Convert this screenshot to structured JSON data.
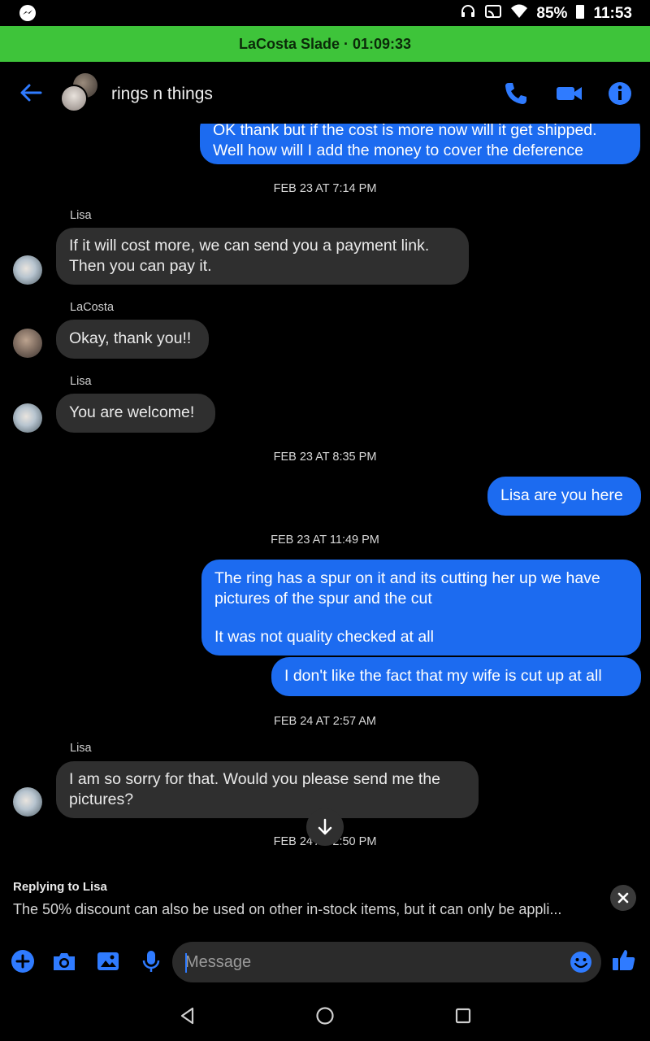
{
  "status_bar": {
    "battery": "85%",
    "time": "11:53"
  },
  "call_banner": {
    "text": "LaCosta Slade · 01:09:33"
  },
  "header": {
    "title": "rings n things"
  },
  "messages": {
    "out_top_line1": "OK thank but if the cost is more now will it get shipped.",
    "out_top_line2": "Well how will I add the money to cover the deference",
    "ts1": "FEB 23 AT 7:14 PM",
    "sender_lisa_1": "Lisa",
    "in1_line1": "If it will cost more, we can send you a payment link.",
    "in1_line2": "Then you can pay it.",
    "sender_lacosta": "LaCosta",
    "in2": "Okay, thank you!!",
    "sender_lisa_2": "Lisa",
    "in3": "You are welcome!",
    "ts2": "FEB 23 AT 8:35 PM",
    "out2": "Lisa are you here",
    "ts3": "FEB 23 AT 11:49 PM",
    "out3_line1": "The ring has a spur on it and its cutting her up we have",
    "out3_line2": "pictures of the spur and the cut",
    "out3_line3": "It was not quality checked at all",
    "out4": "I don't like the fact that my wife is cut up at all",
    "ts4": "FEB 24 AT 2:57 AM",
    "sender_lisa_3": "Lisa",
    "in4_line1": "I am so sorry for that. Would you please send me the",
    "in4_line2": "pictures?",
    "ts5": "FEB 24 AT 2:50 PM"
  },
  "reply": {
    "title": "Replying to Lisa",
    "preview": "The 50% discount can also be used on other in-stock items, but it can only be appli..."
  },
  "composer": {
    "placeholder": "Message"
  },
  "colors": {
    "accent": "#2f7bff",
    "outgoing_bubble": "#1c6bf0",
    "incoming_bubble": "#2f2f2f",
    "call_banner": "#3ec43a"
  }
}
